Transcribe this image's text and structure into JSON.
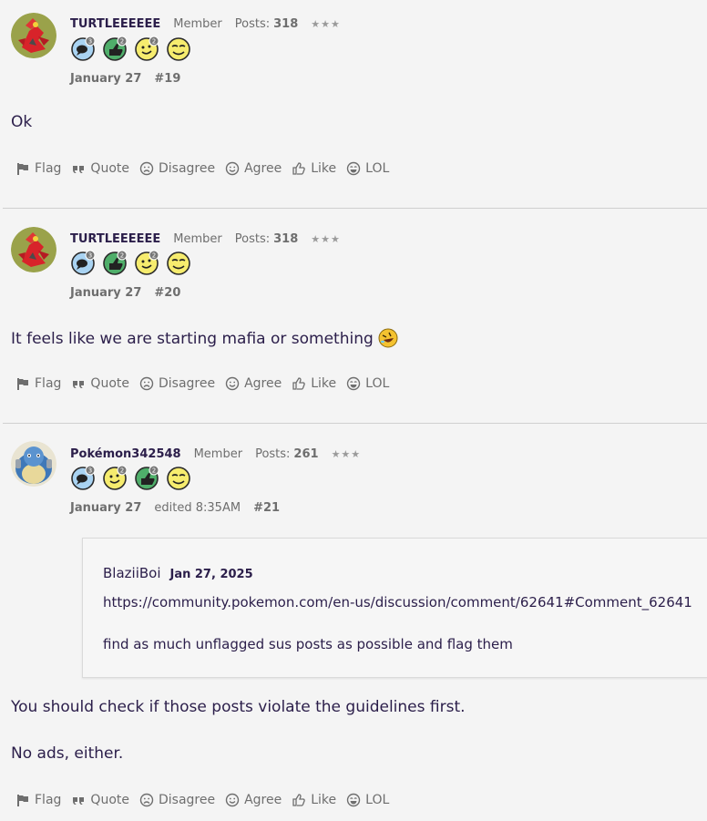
{
  "posts": [
    {
      "username": "TURTLEEEEEE",
      "role": "Member",
      "posts_label": "Posts:",
      "posts_count": "318",
      "stars": "★★★",
      "date": "January 27",
      "edited": "",
      "number": "#19",
      "body": [
        "Ok"
      ],
      "badge_counts": [
        "3",
        "2",
        "2"
      ]
    },
    {
      "username": "TURTLEEEEEE",
      "role": "Member",
      "posts_label": "Posts:",
      "posts_count": "318",
      "stars": "★★★",
      "date": "January 27",
      "edited": "",
      "number": "#20",
      "body": [
        "It feels like we are starting mafia or something"
      ],
      "badge_counts": [
        "3",
        "2",
        "2"
      ]
    },
    {
      "username": "Pokémon342548",
      "role": "Member",
      "posts_label": "Posts:",
      "posts_count": "261",
      "stars": "★★★",
      "date": "January 27",
      "edited": "edited 8:35AM",
      "number": "#21",
      "quote": {
        "user": "BlaziiBoi",
        "date": "Jan 27, 2025",
        "link": "https://community.pokemon.com/en-us/discussion/comment/62641#Comment_62641",
        "text": "find as much unflagged sus posts as possible and flag them"
      },
      "body": [
        "You should check if those posts violate the guidelines first.",
        "No ads, either."
      ],
      "badge_counts": [
        "3",
        "2",
        "2"
      ]
    }
  ],
  "actions": {
    "flag": "Flag",
    "quote": "Quote",
    "disagree": "Disagree",
    "agree": "Agree",
    "like": "Like",
    "lol": "LOL"
  },
  "colors": {
    "text": "#2b1e4a",
    "muted": "#6e6e6e",
    "background": "#f4f4f4",
    "divider": "#cfcfcf"
  },
  "icons": [
    "flag-icon",
    "quote-icon",
    "disagree-icon",
    "agree-icon",
    "like-icon",
    "lol-icon",
    "comment-badge-icon",
    "thumbs-up-badge-icon",
    "smile-badge-icon",
    "wink-badge-icon",
    "rofl-emoji-icon"
  ]
}
